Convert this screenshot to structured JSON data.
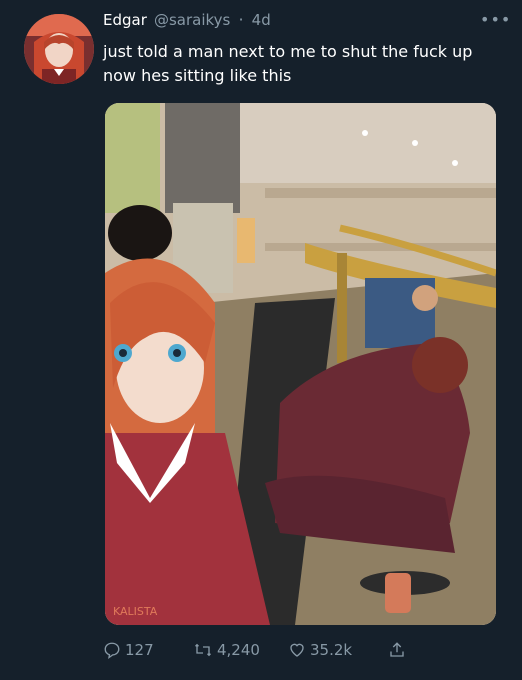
{
  "tweet": {
    "display_name": "Edgar",
    "handle": "@saraikys",
    "time": "4d",
    "more_label": "•••",
    "text": "just told a man next to me to shut the fuck up now hes sitting like this",
    "media": {
      "watermark": "KALISTA"
    },
    "actions": {
      "replies": "127",
      "retweets": "4,240",
      "likes": "35.2k"
    }
  },
  "colors": {
    "background": "#15202b",
    "text": "#ffffff",
    "muted": "#8899a6"
  },
  "icons": [
    "reply-icon",
    "retweet-icon",
    "like-icon",
    "share-icon",
    "more-icon"
  ]
}
